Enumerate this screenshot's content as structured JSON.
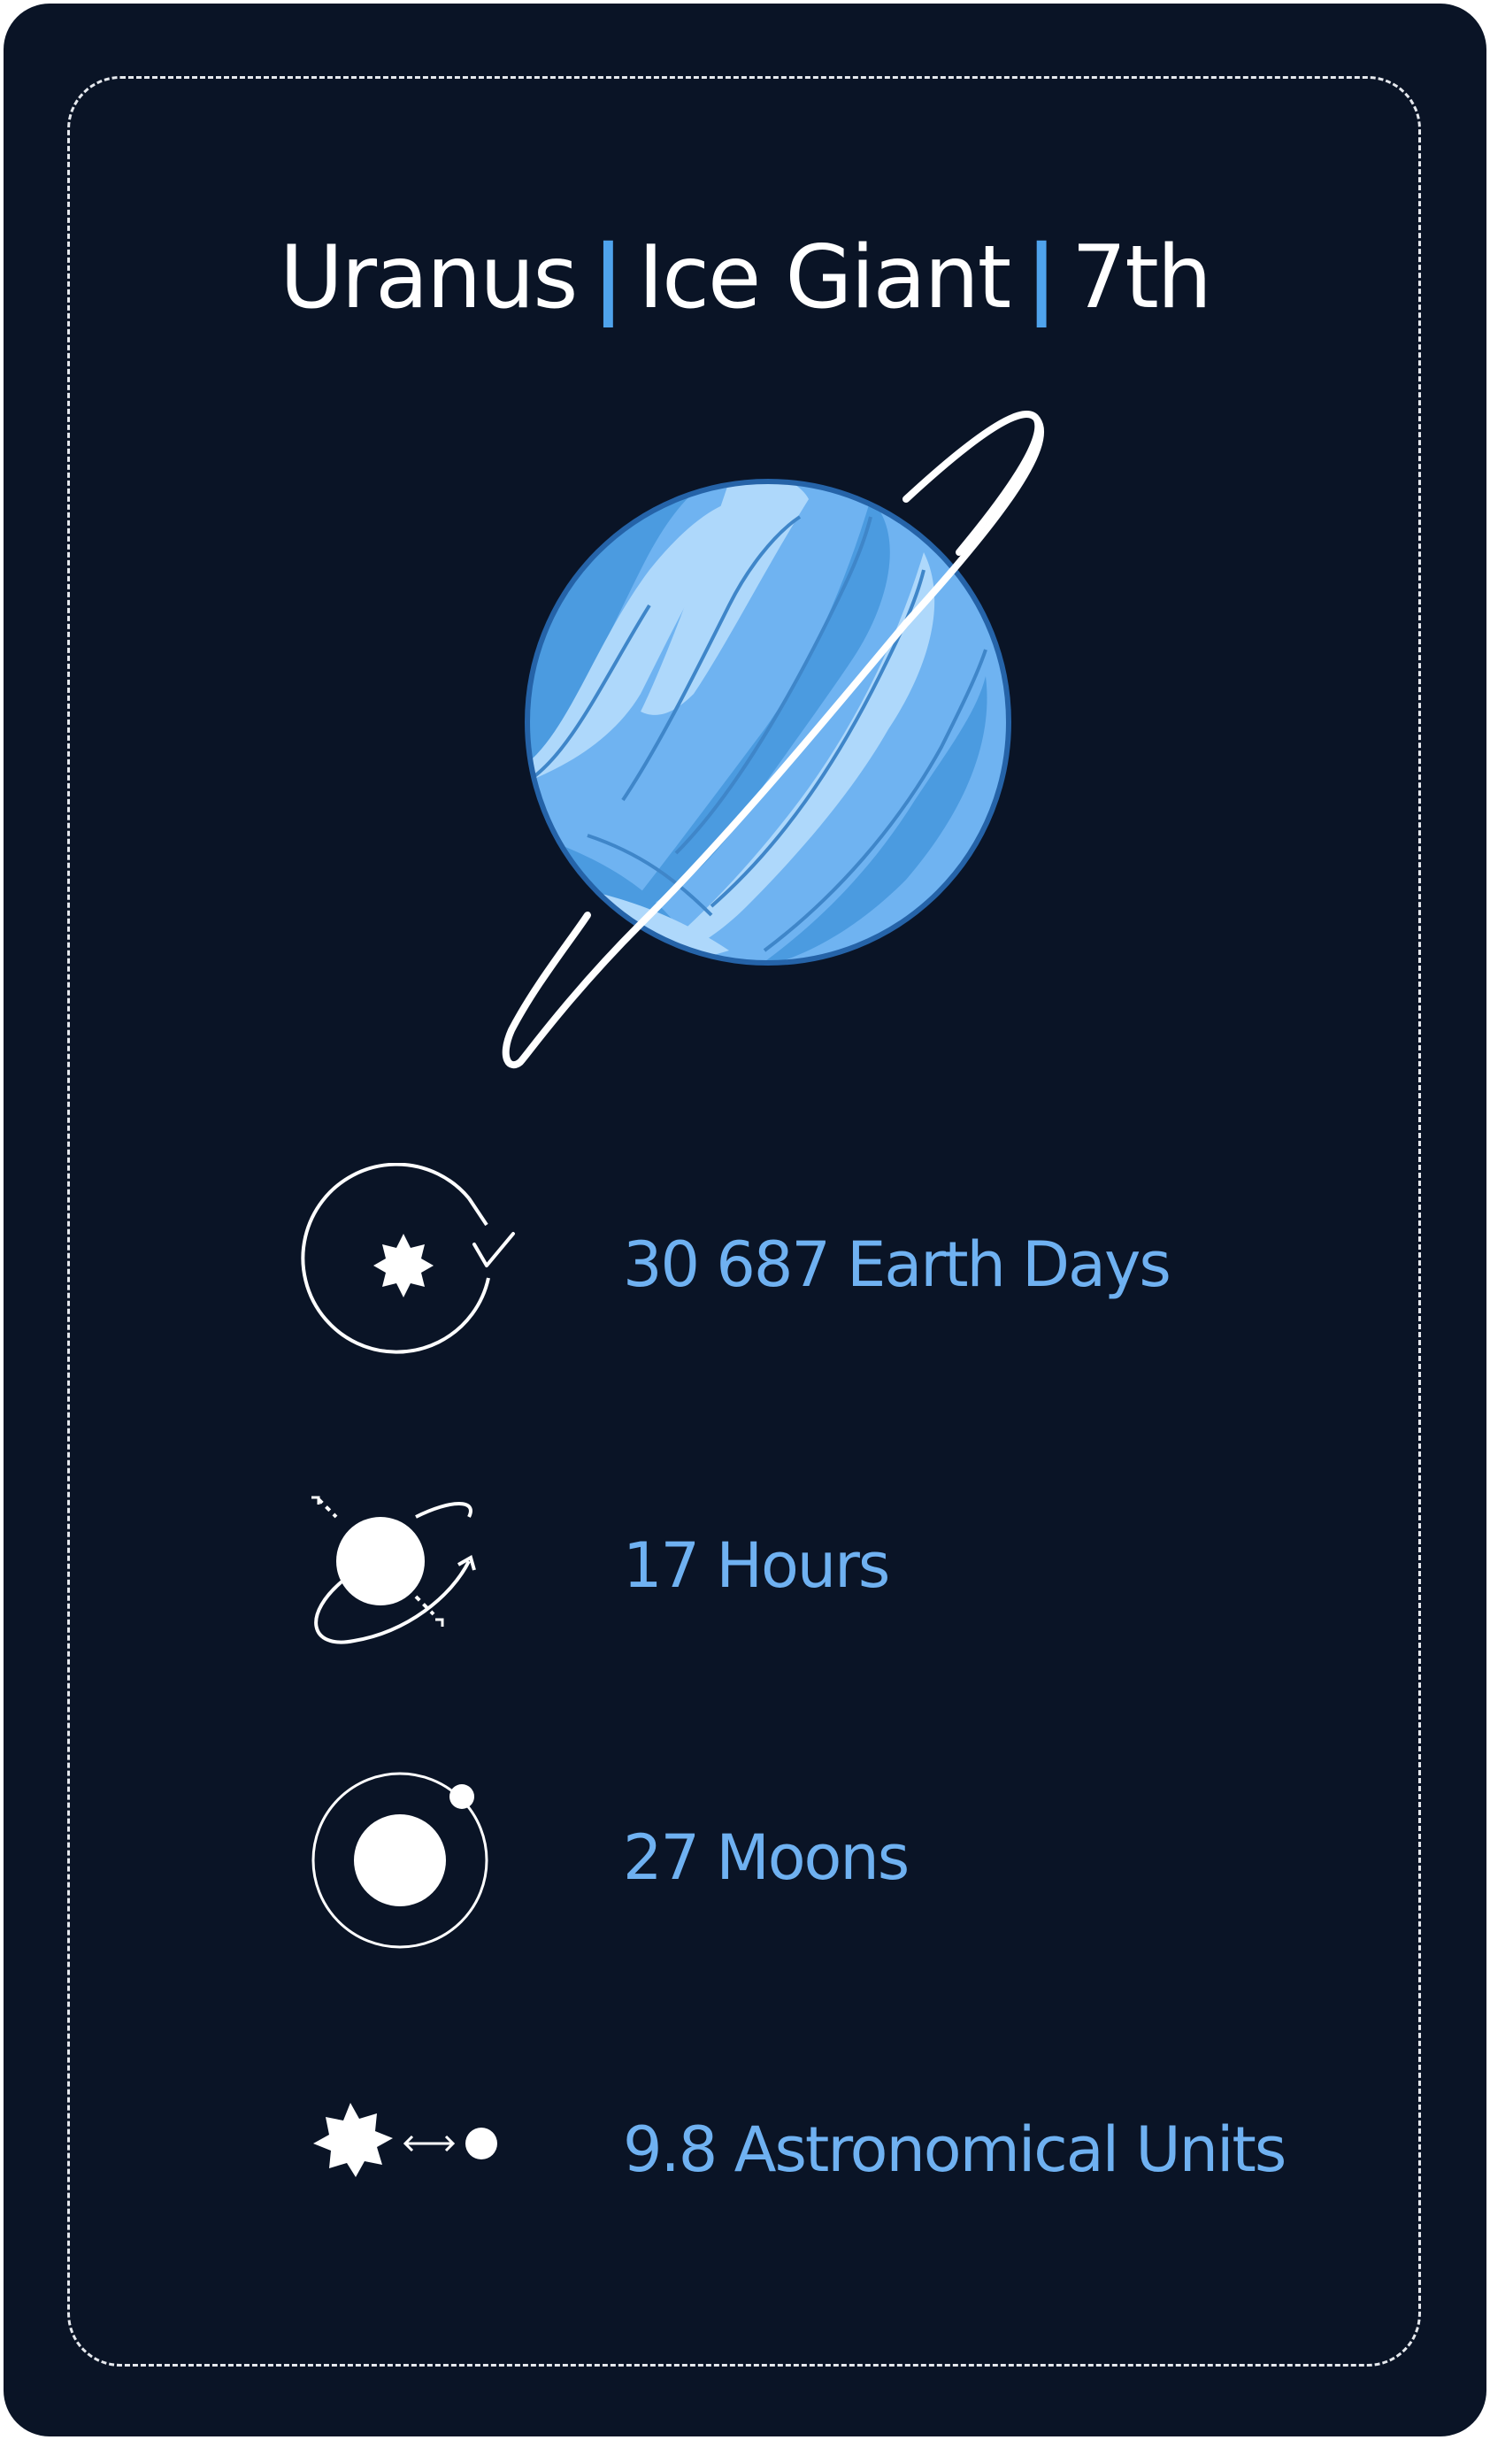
{
  "card": {
    "title": {
      "planet": "Uranus",
      "type": "Ice Giant",
      "order": "7th"
    },
    "stats": [
      {
        "icon": "orbit-period-icon",
        "label": "30 687 Earth Days"
      },
      {
        "icon": "rotation-icon",
        "label": "17 Hours"
      },
      {
        "icon": "moons-icon",
        "label": "27 Moons"
      },
      {
        "icon": "distance-icon",
        "label": "9.8 Astronomical Units"
      }
    ]
  },
  "colors": {
    "background": "#0a1426",
    "accent": "#4fa3ec",
    "stat_text": "#6fb1f1",
    "planet_light": "#aed8fb",
    "planet_mid": "#6fb3f1",
    "planet_dark": "#4b9be0",
    "planet_outline": "#2563a8"
  }
}
